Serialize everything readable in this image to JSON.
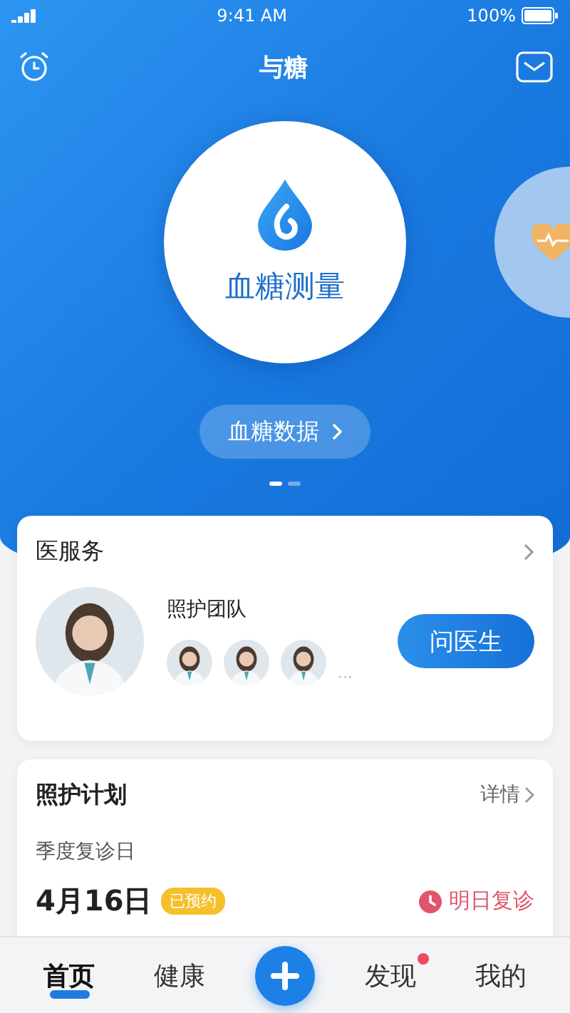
{
  "status_bar": {
    "time": "9:41 AM",
    "battery": "100%"
  },
  "header": {
    "title": "与糖"
  },
  "carousel": {
    "items": [
      {
        "kind": "glucose",
        "label": "血糖测量",
        "selected": true
      },
      {
        "kind": "pressure",
        "selected": false
      }
    ],
    "data_button": "血糖数据",
    "indicators": [
      {
        "selected": true
      },
      {
        "selected": false
      }
    ]
  },
  "service_card": {
    "title": "医服务",
    "team_label": "照护团队",
    "more": "···",
    "ask_button": "问医生"
  },
  "plan_card": {
    "title": "照护计划",
    "detail_link": "详情",
    "label": "季度复诊日",
    "date": "4月16日",
    "badge": "已预约",
    "reminder": "明日复诊"
  },
  "tab_bar": {
    "items": [
      {
        "kind": "tab",
        "label": "首页",
        "selected": true,
        "notification": false
      },
      {
        "kind": "tab",
        "label": "健康",
        "selected": false,
        "notification": false
      },
      {
        "kind": "add"
      },
      {
        "kind": "tab",
        "label": "发现",
        "selected": false,
        "notification": true
      },
      {
        "kind": "tab",
        "label": "我的",
        "selected": false,
        "notification": false
      }
    ]
  }
}
